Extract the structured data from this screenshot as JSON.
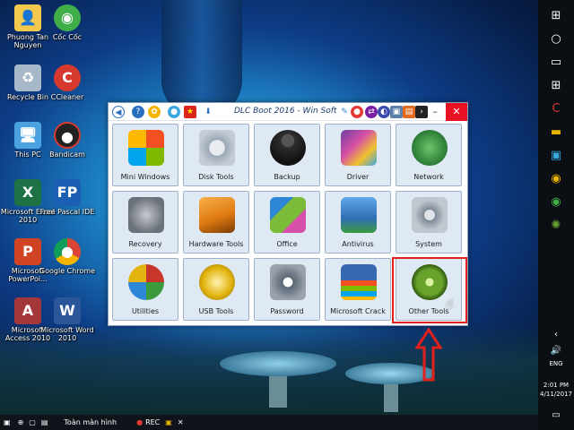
{
  "desktop": {
    "icons": [
      {
        "label": "Phuong Tan Nguyen",
        "icon": "folder-user-icon",
        "color": "#f2c94c"
      },
      {
        "label": "Cốc Cốc",
        "icon": "coccoc-browser-icon",
        "color": "#3fae49"
      },
      {
        "label": "Recycle Bin",
        "icon": "recycle-bin-icon",
        "color": "#a7b8c9"
      },
      {
        "label": "CCleaner",
        "icon": "ccleaner-icon",
        "color": "#d63a2f"
      },
      {
        "label": "This PC",
        "icon": "this-pc-icon",
        "color": "#4aa3e0"
      },
      {
        "label": "Bandicam",
        "icon": "bandicam-icon",
        "color": "#222222"
      },
      {
        "label": "Microsoft Excel 2010",
        "icon": "excel-icon",
        "color": "#1e7145"
      },
      {
        "label": "Free Pascal IDE",
        "icon": "free-pascal-icon",
        "color": "#1b5fb4"
      },
      {
        "label": "Microsoft PowerPoi...",
        "icon": "powerpoint-icon",
        "color": "#d04423"
      },
      {
        "label": "Google Chrome",
        "icon": "chrome-icon",
        "color": "#e8b400"
      },
      {
        "label": "Microsoft Access 2010",
        "icon": "access-icon",
        "color": "#a4373a"
      },
      {
        "label": "Microsoft Word 2010",
        "icon": "word-icon",
        "color": "#2b579a"
      }
    ]
  },
  "window": {
    "title": "DLC Boot 2016 - Win Soft",
    "minimize": "–",
    "maximize": "□",
    "close": "✕"
  },
  "tiles": [
    {
      "label": "Mini Windows",
      "icon": "mini-windows-icon",
      "color": "#c8c8c8"
    },
    {
      "label": "Disk Tools",
      "icon": "disk-tools-icon",
      "color": "#9aa7b5"
    },
    {
      "label": "Backup",
      "icon": "backup-icon",
      "color": "#2e2e2e"
    },
    {
      "label": "Driver",
      "icon": "driver-icon",
      "color": "#6b3fa0"
    },
    {
      "label": "Network",
      "icon": "network-icon",
      "color": "#3a9a3e"
    },
    {
      "label": "Recovery",
      "icon": "recovery-icon",
      "color": "#8a8f96"
    },
    {
      "label": "Hardware Tools",
      "icon": "hardware-tools-icon",
      "color": "#e07b12"
    },
    {
      "label": "Office",
      "icon": "office-icon",
      "color": "#2e86d6"
    },
    {
      "label": "Antivirus",
      "icon": "antivirus-icon",
      "color": "#2f6fb4"
    },
    {
      "label": "System",
      "icon": "system-icon",
      "color": "#7d8a97"
    },
    {
      "label": "Utilities",
      "icon": "utilities-icon",
      "color": "#c7352b"
    },
    {
      "label": "USB Tools",
      "icon": "usb-tools-icon",
      "color": "#e3b40f"
    },
    {
      "label": "Password",
      "icon": "password-icon",
      "color": "#5b6675"
    },
    {
      "label": "Microsoft Crack",
      "icon": "microsoft-crack-icon",
      "color": "#3568b0"
    },
    {
      "label": "Other Tools",
      "icon": "other-tools-icon",
      "color": "#6aa32b"
    }
  ],
  "taskbar": {
    "language": "ENG",
    "time": "2:01 PM",
    "date": "4/11/2017"
  },
  "recbar": {
    "fullscreen": "Toàn màn hình",
    "rec": "REC"
  },
  "colors": {
    "highlight": "#e0201a",
    "tile_bg": "#dfe9f4"
  }
}
